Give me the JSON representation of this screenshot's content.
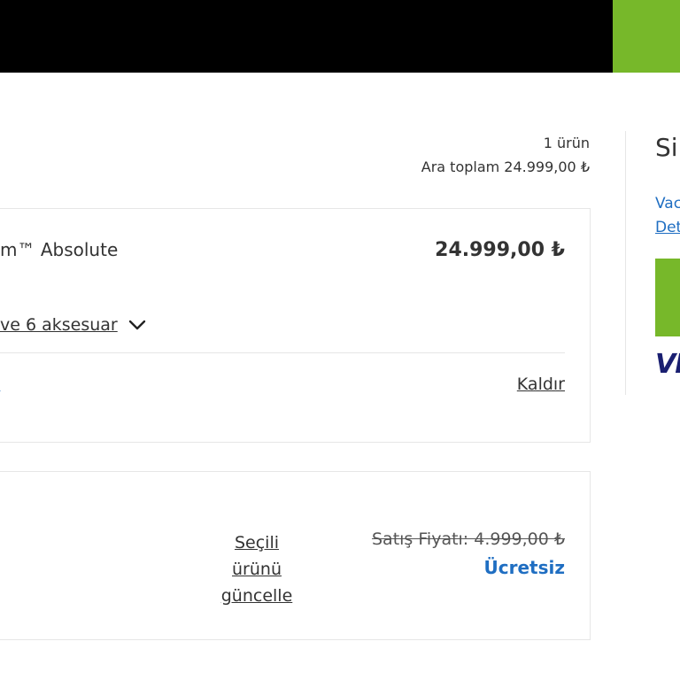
{
  "colors": {
    "header": "#000000",
    "accent_green": "#77b82a",
    "link_blue": "#1f6ec2",
    "visa_blue": "#1a1f71"
  },
  "cart": {
    "item_count": "1 ürün",
    "subtotal": "Ara toplam 24.999,00 ₺"
  },
  "product": {
    "name": "m™ Absolute",
    "price": "24.999,00 ₺",
    "accessories_label": "ve 6 aksesuar",
    "left_link_stub": ":",
    "remove_label": "Kaldır"
  },
  "offer": {
    "update_label": "Seçili ürünü güncelle",
    "old_price": "Satış Fiyatı: 4.999,00 ₺",
    "free_label": "Ücretsiz"
  },
  "summary": {
    "title": "Sip",
    "link1": "Vac",
    "link2": "Det",
    "card_brand": "VI"
  }
}
